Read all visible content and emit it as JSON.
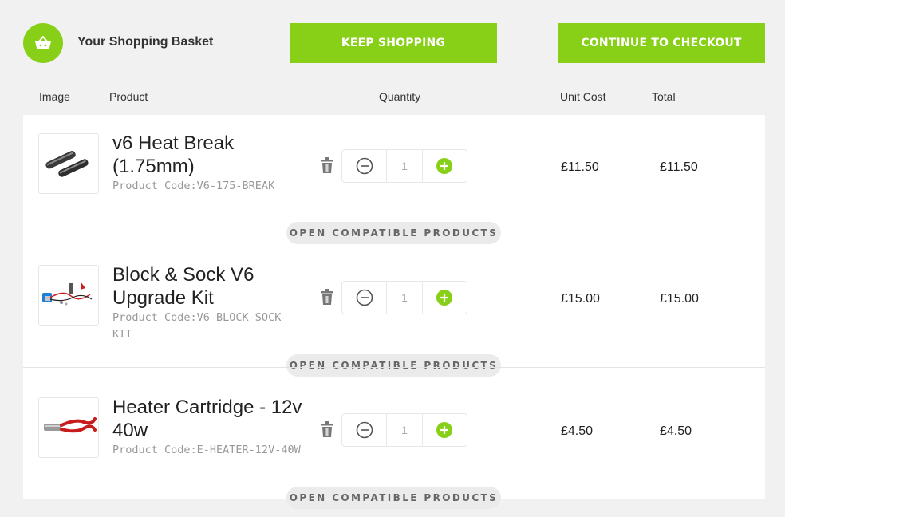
{
  "header": {
    "title": "Your Shopping Basket",
    "keep_shopping": "KEEP SHOPPING",
    "checkout": "CONTINUE TO CHECKOUT",
    "basket_icon": "basket-icon"
  },
  "columns": {
    "image": "Image",
    "product": "Product",
    "quantity": "Quantity",
    "unit_cost": "Unit Cost",
    "total": "Total"
  },
  "items": [
    {
      "name": "v6 Heat Break (1.75mm)",
      "code": "Product Code:V6-175-BREAK",
      "quantity": "1",
      "unit_cost": "£11.50",
      "total": "£11.50",
      "compat": "OPEN COMPATIBLE PRODUCTS"
    },
    {
      "name": "Block & Sock V6 Upgrade Kit",
      "code": "Product Code:V6-BLOCK-SOCK-KIT",
      "quantity": "1",
      "unit_cost": "£15.00",
      "total": "£15.00",
      "compat": "OPEN COMPATIBLE PRODUCTS"
    },
    {
      "name": "Heater Cartridge - 12v 40w",
      "code": "Product Code:E-HEATER-12V-40W",
      "quantity": "1",
      "unit_cost": "£4.50",
      "total": "£4.50",
      "compat": "OPEN COMPATIBLE PRODUCTS"
    }
  ],
  "colors": {
    "accent": "#88cf17",
    "panel_bg": "#f1f1f1",
    "muted": "#999999"
  }
}
